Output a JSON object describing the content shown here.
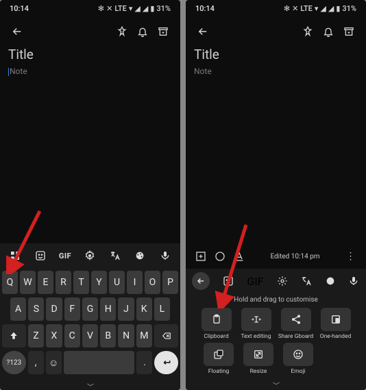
{
  "status": {
    "time": "10:14",
    "battery": "31%",
    "net": "LTE"
  },
  "appbar_icons": [
    "back",
    "pin",
    "bell",
    "archive"
  ],
  "content": {
    "title": "Title",
    "note": "Note"
  },
  "bottombar": {
    "edited": "Edited 10:14 pm"
  },
  "toolbar_left": {
    "gif_label": "GIF"
  },
  "keyboard": {
    "row1": [
      "Q",
      "W",
      "E",
      "R",
      "T",
      "Y",
      "U",
      "I",
      "O",
      "P"
    ],
    "row2": [
      "A",
      "S",
      "D",
      "F",
      "G",
      "H",
      "J",
      "K",
      "L"
    ],
    "row3": [
      "Z",
      "X",
      "C",
      "V",
      "B",
      "N",
      "M"
    ],
    "sym": "?123",
    "comma": ",",
    "period": "."
  },
  "panel": {
    "gif_label": "GIF",
    "hint": "Hold and drag to customise",
    "tiles_row1": [
      {
        "name": "clipboard",
        "label": "Clipboard"
      },
      {
        "name": "textediting",
        "label": "Text editing"
      },
      {
        "name": "sharegboard",
        "label": "Share Gboard"
      },
      {
        "name": "onehanded",
        "label": "One-handed"
      }
    ],
    "tiles_row2": [
      {
        "name": "floating",
        "label": "Floating"
      },
      {
        "name": "resize",
        "label": "Resize"
      },
      {
        "name": "emoji",
        "label": "Emoji"
      }
    ]
  }
}
